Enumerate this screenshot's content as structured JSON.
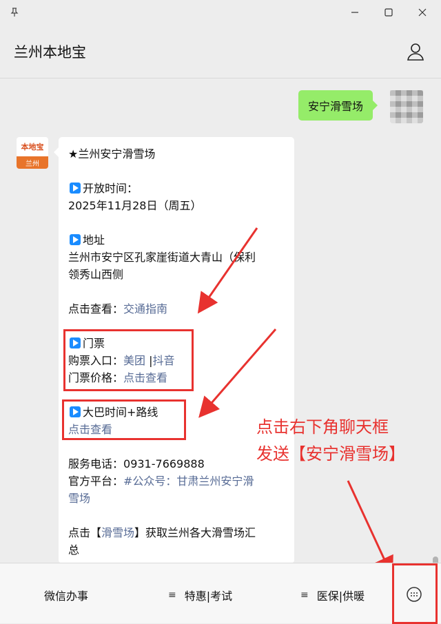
{
  "window": {
    "pin_icon": "pin-icon",
    "minimize_icon": "minimize-icon",
    "maximize_icon": "maximize-icon",
    "close_icon": "close-icon"
  },
  "header": {
    "title": "兰州本地宝",
    "user_icon": "user-icon"
  },
  "my_message": {
    "text": "安宁滑雪场"
  },
  "bot_avatar": {
    "logo_text": "本地宝",
    "city_text": "兰州"
  },
  "message": {
    "title": "★兰州安宁滑雪场",
    "open_label": "开放时间：",
    "open_value": "2025年11月28日（周五）",
    "address_label": "地址",
    "address_line1": "兰州市安宁区孔家崖街道大青山（保利",
    "address_line2": "领秀山西侧",
    "traffic_prefix": "点击查看：",
    "traffic_link": "交通指南",
    "ticket_label": "门票",
    "buy_prefix": "购票入口：",
    "buy_link1": "美团",
    "buy_sep": "|",
    "buy_link2": "抖音",
    "price_prefix": "门票价格：",
    "price_link": "点击查看",
    "bus_label": "大巴时间+路线",
    "bus_link": "点击查看",
    "phone_prefix": "服务电话：",
    "phone_value": "0931-7669888",
    "official_prefix": "官方平台：",
    "official_link_line1": "#公众号：甘肃兰州安宁滑",
    "official_link_line2": "雪场",
    "more_prefix": "点击【",
    "more_link": "滑雪场",
    "more_suffix_line1": "】获取兰州各大滑雪场汇",
    "more_suffix_line2": "总"
  },
  "annotation": {
    "line1": "点击右下角聊天框",
    "line2": "发送【安宁滑雪场】",
    "color": "#e8322f"
  },
  "bottom_menu": {
    "item1": "微信办事",
    "item2": "特惠|考试",
    "item3": "医保|供暖",
    "menu_icon": "≡",
    "keyboard_icon": "keyboard-icon"
  }
}
